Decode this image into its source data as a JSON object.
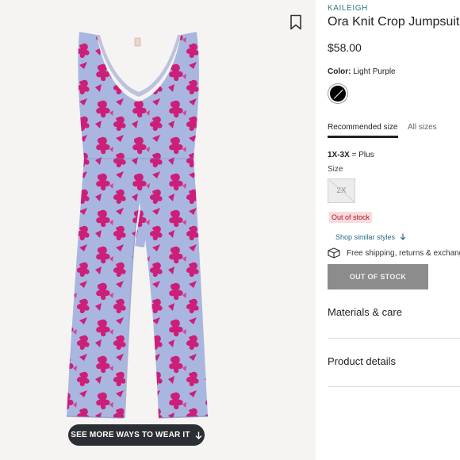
{
  "product": {
    "brand": "KAILEIGH",
    "title": "Ora Knit Crop Jumpsuit",
    "price": "$58.00",
    "color_label": "Color:",
    "color_value": "Light Purple",
    "image_button": "SEE MORE WAYS TO WEAR IT"
  },
  "size_tabs": {
    "recommended": "Recommended size",
    "all": "All sizes"
  },
  "size": {
    "range": "1X-3X",
    "range_suffix": "= Plus",
    "label": "Size",
    "selected": "2X",
    "stock_badge": "Out of stock"
  },
  "actions": {
    "similar": "Shop similar styles",
    "shipping": "Free shipping, returns & exchanges",
    "main_button": "OUT OF STOCK"
  },
  "accordions": {
    "materials": "Materials & care",
    "product_details": "Product details"
  },
  "colors": {
    "brand_teal": "#2a7b79",
    "jumpsuit_base": "#a9b6e0",
    "jumpsuit_print": "#cc1f7a",
    "out_of_stock_badge": "#f7dcde"
  }
}
